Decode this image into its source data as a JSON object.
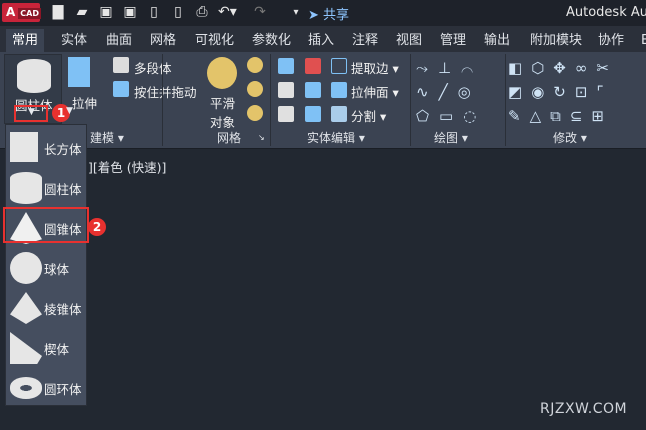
{
  "titlebar": {
    "logo": "A",
    "logo_sub": "CAD",
    "share": "共享",
    "title": "Autodesk Aut",
    "quick_access": [
      "new-icon",
      "open-icon",
      "save-icon",
      "save-as-icon",
      "open-from-web-icon",
      "save-to-web-icon",
      "plot-icon",
      "undo-icon",
      "redo-icon",
      "customize-icon"
    ]
  },
  "tabs": [
    "常用",
    "实体",
    "曲面",
    "网格",
    "可视化",
    "参数化",
    "插入",
    "注释",
    "视图",
    "管理",
    "输出",
    "附加模块",
    "协作",
    "Ex"
  ],
  "active_tab": "常用",
  "ribbon": {
    "modeling": {
      "cylinder": "圆柱体",
      "extrude": "拉伸",
      "polysolid": "多段体",
      "presspull": "按住并拖动",
      "label": "建模"
    },
    "mesh": {
      "smooth": "平滑",
      "object": "对象",
      "label": "网格"
    },
    "solid_edit": {
      "extract_edges": "提取边",
      "extrude_faces": "拉伸面",
      "slice": "分割",
      "label": "实体编辑"
    },
    "draw": {
      "label": "绘图"
    },
    "modify": {
      "label": "修改"
    }
  },
  "view_label": "][着色 (快速)]",
  "menu": {
    "items": [
      "长方体",
      "圆柱体",
      "圆锥体",
      "球体",
      "棱锥体",
      "楔体",
      "圆环体"
    ],
    "selected": "圆锥体"
  },
  "badges": [
    "1",
    "2"
  ],
  "watermark": "RJZXW.COM",
  "colors": {
    "accent": "#e8312f",
    "ribbon": "#3b4352",
    "canvas": "#222831"
  }
}
